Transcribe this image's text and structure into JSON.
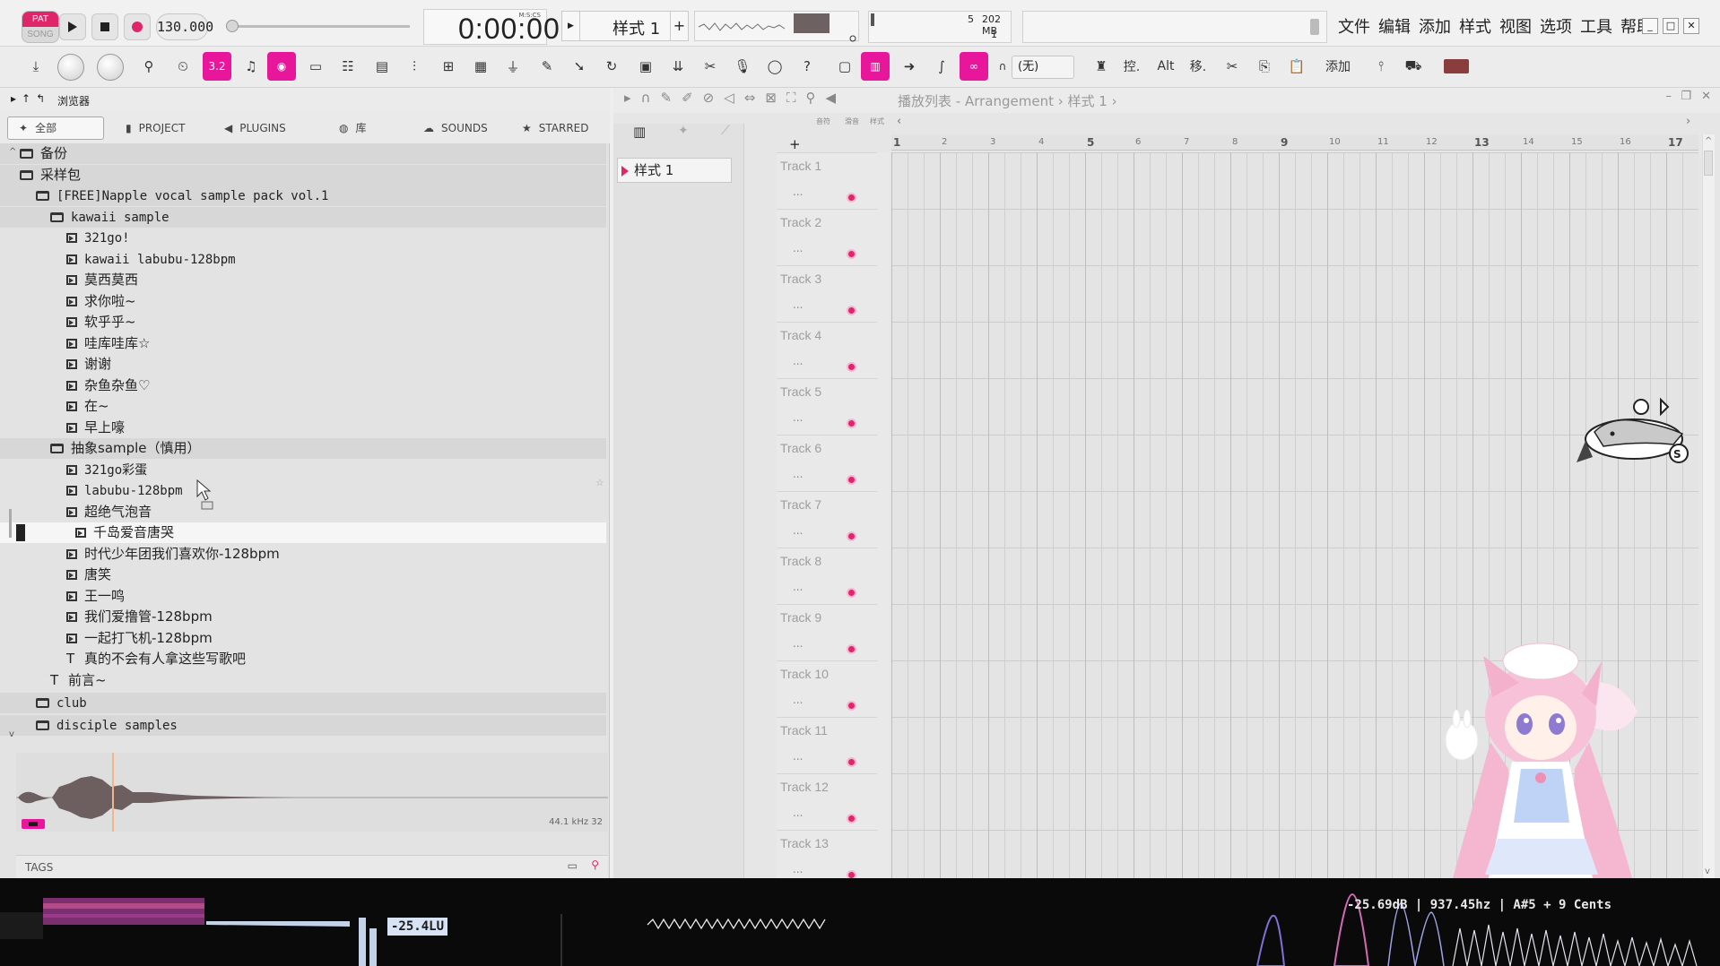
{
  "transport": {
    "pat_label": "PAT",
    "song_label": "SONG",
    "tempo": "130.000",
    "time": "0:00:00",
    "time_unit": "M:S:CS",
    "pattern": "样式 1",
    "cpu_value": "5",
    "memory": "202 MB",
    "poly": "1"
  },
  "menu": [
    "文件",
    "编辑",
    "添加",
    "样式",
    "视图",
    "选项",
    "工具",
    "帮助"
  ],
  "toolbar": {
    "speed_label": "3.2",
    "ctrl_label": "控.",
    "alt_label": "Alt",
    "move_label": "移.",
    "add_label": "添加",
    "none_label": "(无)"
  },
  "browser": {
    "title": "浏览器",
    "tabs": [
      "全部",
      "PROJECT",
      "PLUGINS",
      "库",
      "SOUNDS",
      "STARRED"
    ],
    "rows": [
      {
        "label": "备份",
        "type": "folder",
        "indent": 0
      },
      {
        "label": "采样包",
        "type": "folder",
        "indent": 0
      },
      {
        "label": "[FREE]Napple vocal sample pack vol.1",
        "type": "folder",
        "indent": 1
      },
      {
        "label": "kawaii sample",
        "type": "folder",
        "indent": 2
      },
      {
        "label": "321go!",
        "type": "audio",
        "indent": 3
      },
      {
        "label": "kawaii labubu-128bpm",
        "type": "audio",
        "indent": 3
      },
      {
        "label": "莫西莫西",
        "type": "audio",
        "indent": 3
      },
      {
        "label": "求你啦~",
        "type": "audio",
        "indent": 3
      },
      {
        "label": "软乎乎~",
        "type": "audio",
        "indent": 3
      },
      {
        "label": "哇库哇库☆",
        "type": "audio",
        "indent": 3
      },
      {
        "label": "谢谢",
        "type": "audio",
        "indent": 3
      },
      {
        "label": "杂鱼杂鱼♡",
        "type": "audio",
        "indent": 3
      },
      {
        "label": "在~",
        "type": "audio",
        "indent": 3
      },
      {
        "label": "早上嚎",
        "type": "audio",
        "indent": 3
      },
      {
        "label": "抽象sample（慎用）",
        "type": "folder",
        "indent": 2
      },
      {
        "label": "321go彩蛋",
        "type": "audio",
        "indent": 3
      },
      {
        "label": "labubu-128bpm",
        "type": "audio",
        "indent": 3
      },
      {
        "label": "超绝气泡音",
        "type": "audio",
        "indent": 3
      },
      {
        "label": "千岛爱音唐哭",
        "type": "audio",
        "indent": 3,
        "selected": true
      },
      {
        "label": "时代少年团我们喜欢你-128bpm",
        "type": "audio",
        "indent": 3
      },
      {
        "label": "唐笑",
        "type": "audio",
        "indent": 3
      },
      {
        "label": "王一鸣",
        "type": "audio",
        "indent": 3
      },
      {
        "label": "我们爱撸管-128bpm",
        "type": "audio",
        "indent": 3
      },
      {
        "label": "一起打飞机-128bpm",
        "type": "audio",
        "indent": 3
      },
      {
        "label": "真的不会有人拿这些写歌吧",
        "type": "text",
        "indent": 3
      },
      {
        "label": "前言~",
        "type": "text",
        "indent": 2
      },
      {
        "label": "club",
        "type": "folder",
        "indent": 1
      },
      {
        "label": "disciple samples",
        "type": "folder",
        "indent": 1
      }
    ],
    "sample_info": "44.1 kHz 32",
    "tags_label": "TAGS"
  },
  "playlist": {
    "title": "播放列表 - Arrangement",
    "pattern_crumb": "样式 1",
    "pattern_item": "样式 1",
    "header_tabs": [
      "音符",
      "滑音",
      "样式"
    ],
    "tracks": [
      "Track 1",
      "Track 2",
      "Track 3",
      "Track 4",
      "Track 5",
      "Track 6",
      "Track 7",
      "Track 8",
      "Track 9",
      "Track 10",
      "Track 11",
      "Track 12",
      "Track 13"
    ],
    "ellipsis": "...",
    "ruler": [
      "1",
      "2",
      "3",
      "4",
      "5",
      "6",
      "7",
      "8",
      "9",
      "10",
      "11",
      "12",
      "13",
      "14",
      "15",
      "16",
      "17"
    ]
  },
  "visualizer": {
    "loudness": "-25.4LU",
    "readout": "-25.69dB | 937.45hz | A#5 + 9 Cents"
  },
  "colors": {
    "accent": "#e0266a",
    "accent_tool": "#e7169a",
    "background": "#eeeeee"
  }
}
